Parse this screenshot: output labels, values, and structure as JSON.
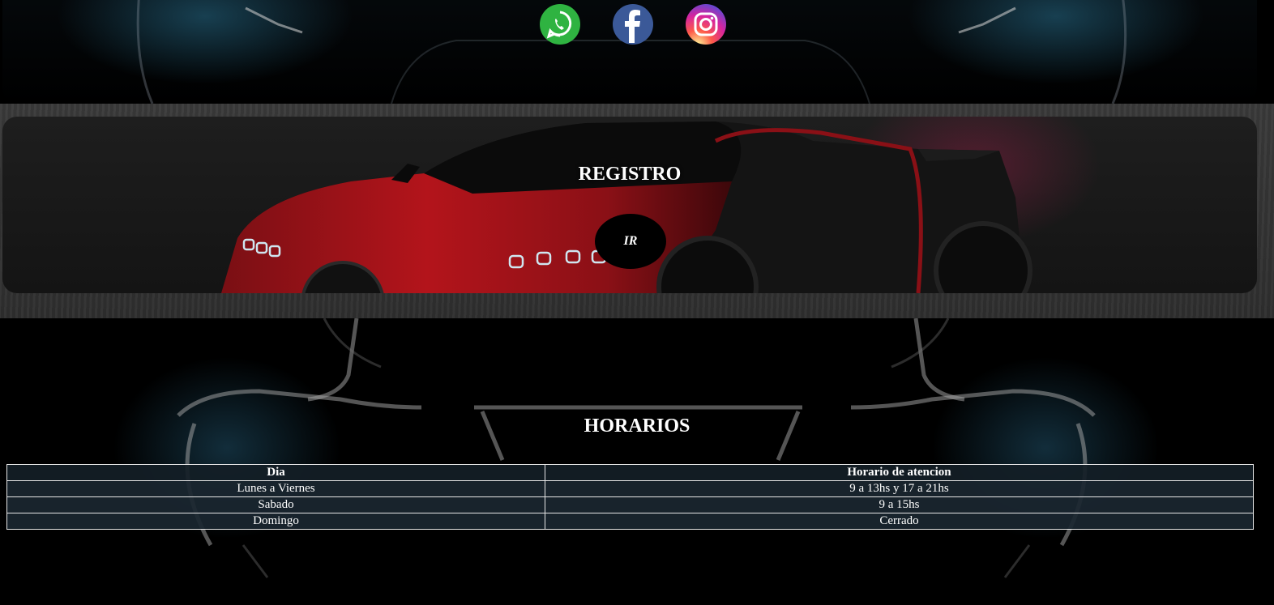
{
  "social": {
    "icons": [
      {
        "name": "whatsapp-icon",
        "color": "#2fb341"
      },
      {
        "name": "facebook-icon",
        "color": "#3b5998"
      },
      {
        "name": "instagram-icon",
        "color": "#d6249f"
      }
    ]
  },
  "registro": {
    "title": "REGISTRO",
    "button_label": "IR"
  },
  "horarios": {
    "title": "HORARIOS",
    "headers": [
      "Dia",
      "Horario de atencion"
    ],
    "rows": [
      [
        "Lunes a Viernes",
        "9 a 13hs y 17 a 21hs"
      ],
      [
        "Sabado",
        "9 a 15hs"
      ],
      [
        "Domingo",
        "Cerrado"
      ]
    ]
  }
}
